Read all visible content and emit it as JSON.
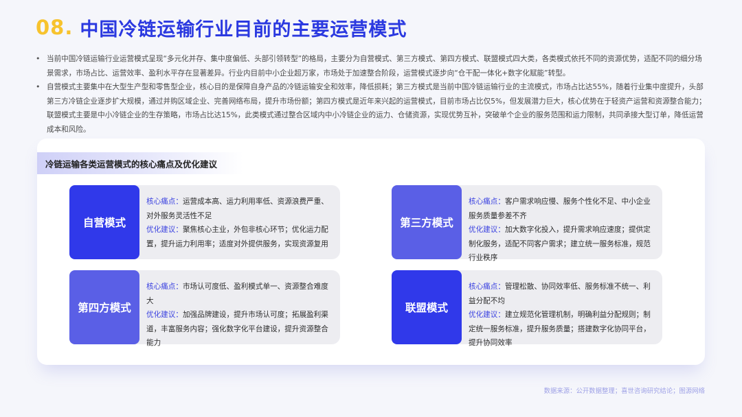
{
  "title": {
    "number": "08.",
    "text": "中国冷链运输行业目前的主要运营模式"
  },
  "bullets": [
    "当前中国冷链运输行业运营模式呈现“多元化并存、集中度偏低、头部引领转型”的格局，主要分为自营模式、第三方模式、第四方模式、联盟模式四大类，各类模式依托不同的资源优势，适配不同的细分场景需求，市场占比、运营效率、盈利水平存在显著差异。行业内目前中小企业超万家，市场处于加速整合阶段，运营模式逐步向“仓干配一体化+数字化赋能”转型。",
    "自营模式主要集中在大型生产型和零售型企业，核心目的是保障自身产品的冷链运输安全和效率，降低损耗；第三方模式是当前中国冷链运输行业的主流模式，市场占比达55%，随着行业集中度提升，头部第三方冷链企业逐步扩大规模，通过并购区域企业、完善网络布局，提升市场份额；第四方模式是近年来兴起的运营模式，目前市场占比仅5%，但发展潜力巨大，核心优势在于轻资产运营和资源整合能力；联盟模式主要是中小冷链企业的生存策略，市场占比达15%，此类模式通过整合区域内中小冷链企业的运力、仓储资源，实现优势互补，突破单个企业的服务范围和运力限制，共同承接大型订单，降低运营成本和风险。"
  ],
  "panel": {
    "header": "冷链运输各类运营模式的核心痛点及优化建议",
    "cards": [
      {
        "mode": "自营模式",
        "pain_label": "核心痛点：",
        "pain": "运营成本高、运力利用率低、资源浪费严重、对外服务灵活性不足",
        "advice_label": "优化建议：",
        "advice": "聚焦核心主业，外包非核心环节；优化运力配置，提升运力利用率；适度对外提供服务，实现资源复用"
      },
      {
        "mode": "第三方模式",
        "pain_label": "核心痛点：",
        "pain": "客户需求响应慢、服务个性化不足、中小企业服务质量参差不齐",
        "advice_label": "优化建议：",
        "advice": "加大数字化投入，提升需求响应速度；提供定制化服务，适配不同客户需求；建立统一服务标准，规范行业秩序"
      },
      {
        "mode": "第四方模式",
        "pain_label": "核心痛点：",
        "pain": "市场认可度低、盈利模式单一、资源整合难度大",
        "advice_label": "优化建议：",
        "advice": "加强品牌建设，提升市场认可度；拓展盈利渠道，丰富服务内容；强化数字化平台建设，提升资源整合能力"
      },
      {
        "mode": "联盟模式",
        "pain_label": "核心痛点：",
        "pain": "管理松散、协同效率低、服务标准不统一、利益分配不均",
        "advice_label": "优化建议：",
        "advice": "建立规范化管理机制，明确利益分配规则；制定统一服务标准，提升服务质量；搭建数字化协同平台，提升协同效率"
      }
    ]
  },
  "footer": "数据来源：公开数据整理；喜世咨询研究结论；图源网络",
  "colors": {
    "title_number": "#f7c32e",
    "title_text": "#2b39e0",
    "mode_dark": "#3039ea",
    "mode_light": "#5a5fe6",
    "label": "#3b42e0"
  }
}
